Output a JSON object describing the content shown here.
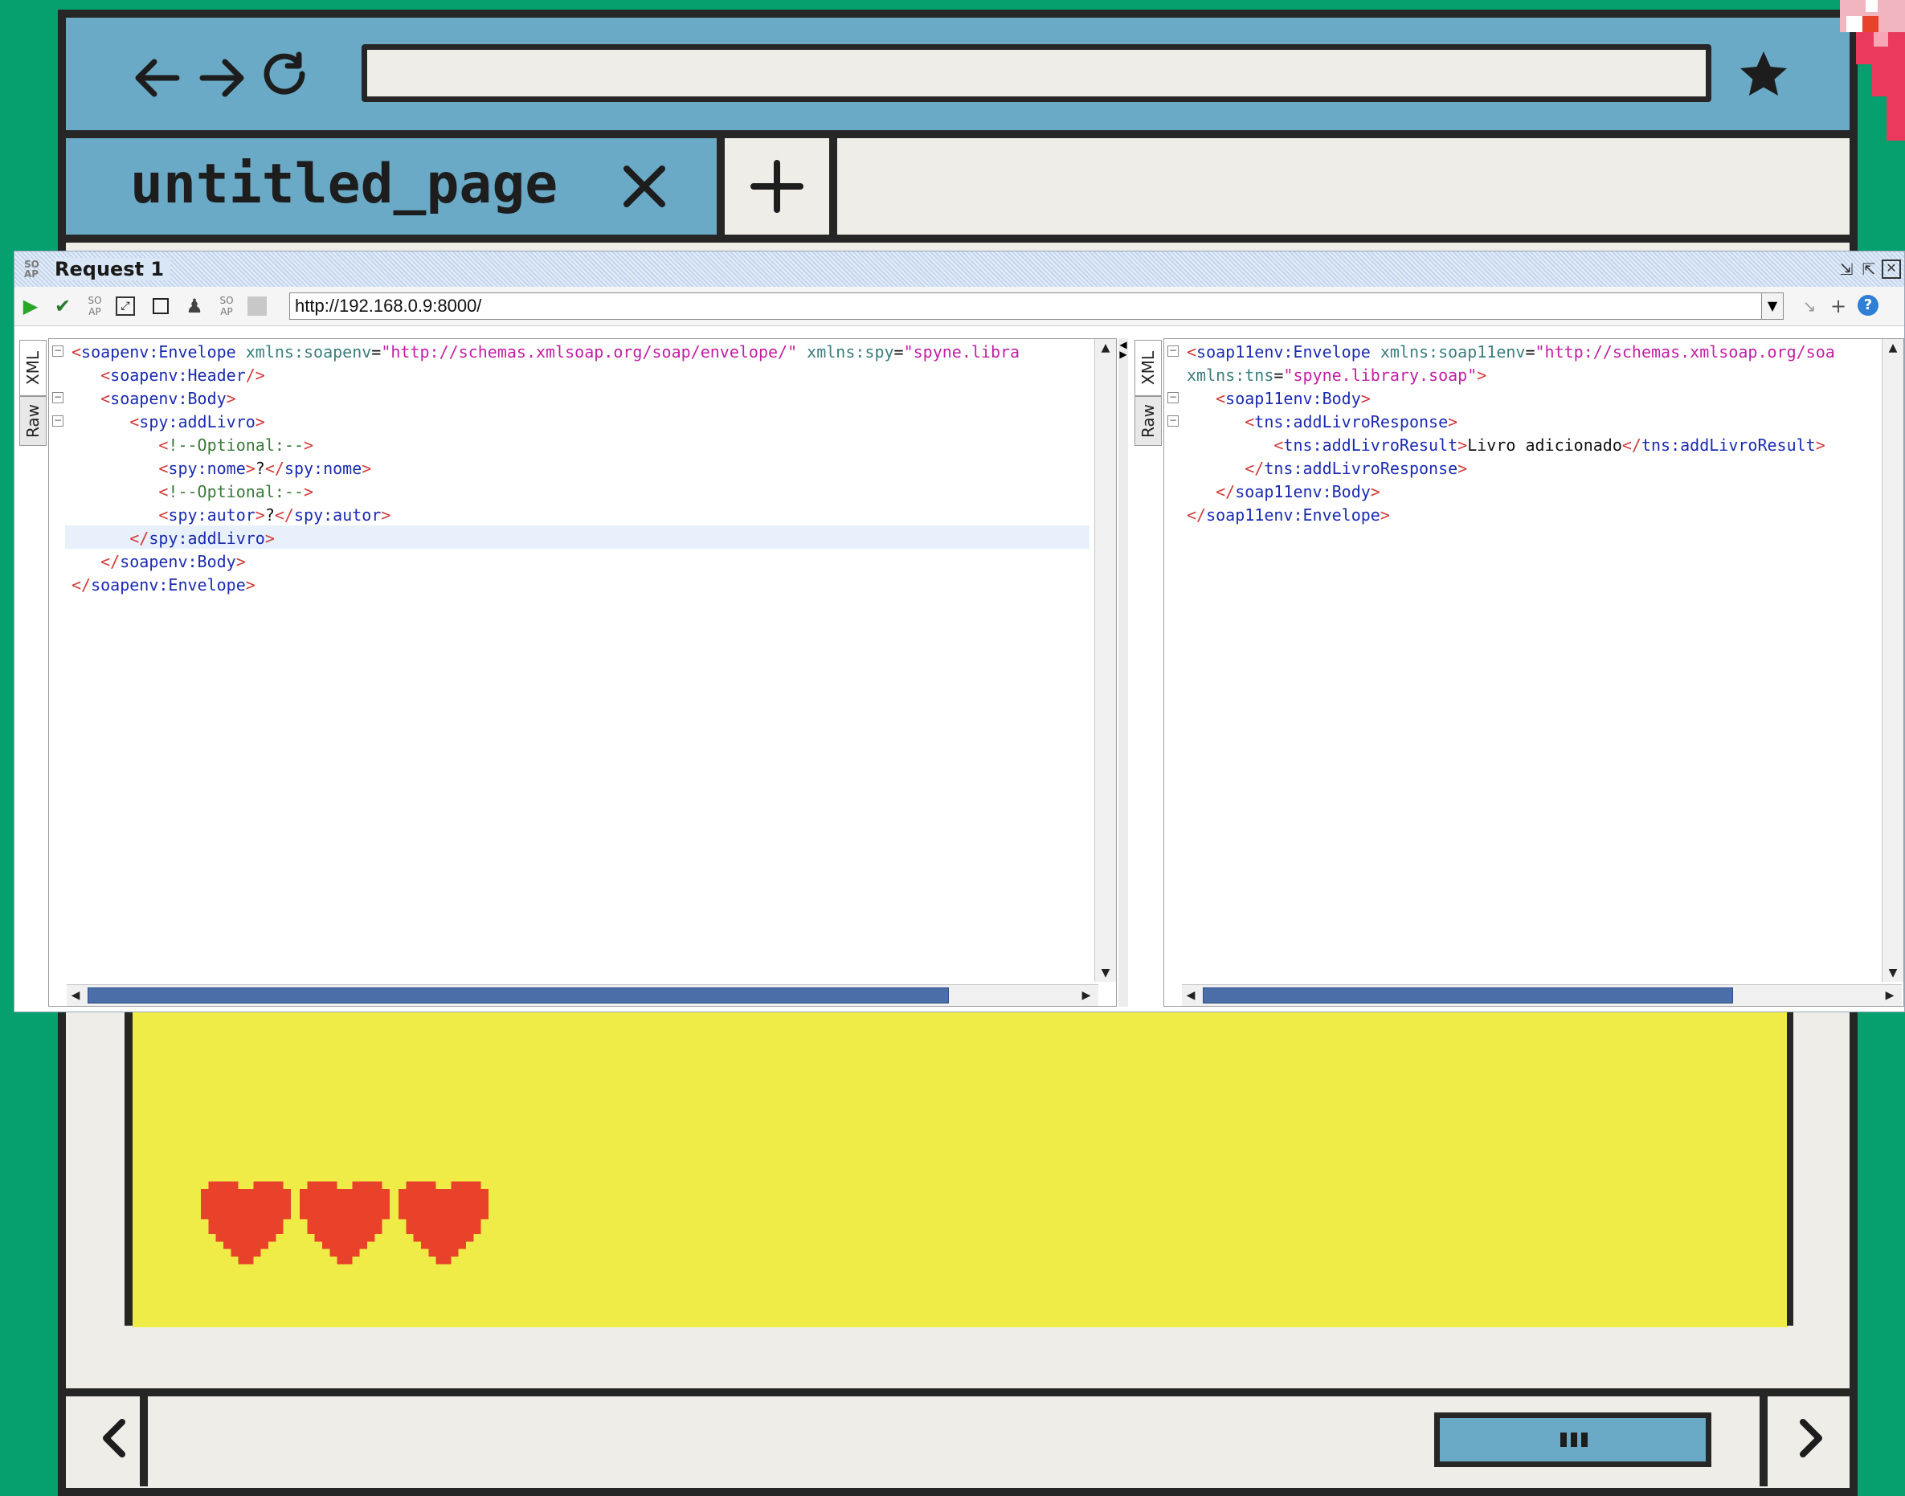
{
  "browser": {
    "tab_title": "untitled_page",
    "url_value": "",
    "icons": [
      "arrow-left-icon",
      "arrow-right-icon",
      "refresh-icon",
      "star-icon",
      "close-icon",
      "plus-icon",
      "chevron-left-icon",
      "chevron-right-icon"
    ]
  },
  "soap": {
    "title": "Request 1",
    "endpoint": "http://192.168.0.9:8000/",
    "request_tabs": [
      "XML",
      "Raw"
    ],
    "response_tabs": [
      "XML",
      "Raw"
    ],
    "request_lines": [
      "<soapenv:Envelope xmlns:soapenv=\"http://schemas.xmlsoap.org/soap/envelope/\" xmlns:spy=\"spyne.libra",
      "   <soapenv:Header/>",
      "   <soapenv:Body>",
      "      <spy:addLivro>",
      "         <!--Optional:-->",
      "         <spy:nome>?</spy:nome>",
      "         <!--Optional:-->",
      "         <spy:autor>?</spy:autor>",
      "      </spy:addLivro>",
      "   </soapenv:Body>",
      "</soapenv:Envelope>"
    ],
    "response_lines": [
      "<soap11env:Envelope xmlns:soap11env=\"http://schemas.xmlsoap.org/soa",
      "xmlns:tns=\"spyne.library.soap\">",
      "   <soap11env:Body>",
      "      <tns:addLivroResponse>",
      "         <tns:addLivroResult>Livro adicionado</tns:addLivroResult>",
      "      </tns:addLivroResponse>",
      "   </soap11env:Body>",
      "</soap11env:Envelope>"
    ]
  },
  "hearts": {
    "count": 3,
    "color": "#e8432a"
  },
  "colors": {
    "accent": "#6aaac6",
    "background": "#05a06e",
    "content": "#efec48"
  }
}
